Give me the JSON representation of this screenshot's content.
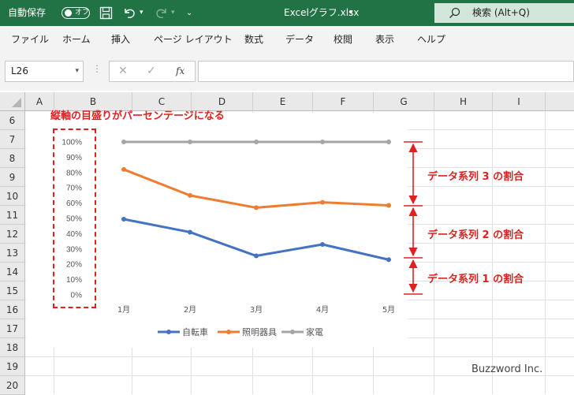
{
  "titlebar": {
    "autosave_label": "自動保存",
    "autosave_state": "オフ",
    "filename": "Excelグラフ.xlsx",
    "search_placeholder": "検索 (Alt+Q)"
  },
  "menu": [
    "ファイル",
    "ホーム",
    "挿入",
    "ページ レイアウト",
    "数式",
    "データ",
    "校閲",
    "表示",
    "ヘルプ"
  ],
  "formula_bar": {
    "name_box": "L26",
    "fx": "fx"
  },
  "columns": [
    "A",
    "B",
    "C",
    "D",
    "E",
    "F",
    "G",
    "H",
    "I"
  ],
  "rows": [
    "6",
    "7",
    "8",
    "9",
    "10",
    "11",
    "12",
    "13",
    "14",
    "15",
    "16",
    "17",
    "18",
    "19",
    "20"
  ],
  "chart_data": {
    "type": "line",
    "categories": [
      "1月",
      "2月",
      "3月",
      "4月",
      "5月"
    ],
    "y_ticks": [
      "0%",
      "10%",
      "20%",
      "30%",
      "40%",
      "50%",
      "60%",
      "70%",
      "80%",
      "90%",
      "100%"
    ],
    "ylim": [
      0,
      100
    ],
    "grid": false,
    "legend_position": "bottom",
    "series": [
      {
        "name": "自転車",
        "color": "#4472c4",
        "values": [
          49.5,
          41,
          25.5,
          33,
          23
        ]
      },
      {
        "name": "照明器具",
        "color": "#ed7d31",
        "values": [
          82,
          65,
          57,
          60.5,
          58.5
        ]
      },
      {
        "name": "家電",
        "color": "#a5a5a5",
        "values": [
          100,
          100,
          100,
          100,
          100
        ]
      }
    ]
  },
  "annotations": {
    "axis_note": "縦軸の目盛りがパーセンテージになる",
    "series3": "データ系列 3 の割合",
    "series2": "データ系列 2 の割合",
    "series1": "データ系列 1 の割合"
  },
  "watermark": "Buzzword Inc."
}
